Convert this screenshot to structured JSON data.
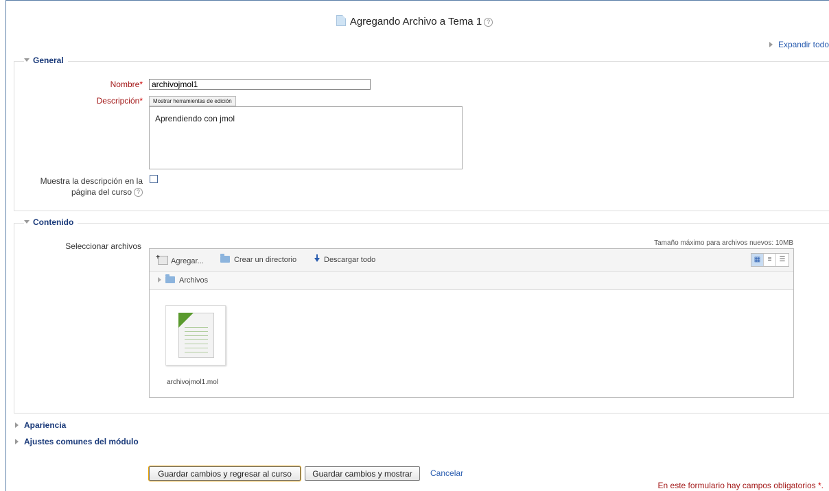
{
  "page": {
    "title": "Agregando Archivo a Tema 1",
    "expand_all": "Expandir todo"
  },
  "general": {
    "legend": "General",
    "name_label": "Nombre",
    "name_value": "archivojmol1",
    "description_label": "Descripción",
    "editor_toggle": "Mostrar herramientas de edición",
    "description_value": "Aprendiendo con jmol",
    "show_desc_label_1": "Muestra la descripción en la",
    "show_desc_label_2": "página del curso",
    "required_mark": "*"
  },
  "content": {
    "legend": "Contenido",
    "select_files_label": "Seleccionar archivos",
    "max_size": "Tamaño máximo para archivos nuevos: 10MB",
    "toolbar": {
      "add": "Agregar...",
      "create_dir": "Crear un directorio",
      "download_all": "Descargar todo"
    },
    "path": "Archivos",
    "file_name": "archivojmol1.mol"
  },
  "sections": {
    "appearance": "Apariencia",
    "common_settings": "Ajustes comunes del módulo"
  },
  "actions": {
    "save_return": "Guardar cambios y regresar al curso",
    "save_show": "Guardar cambios y mostrar",
    "cancel": "Cancelar",
    "required_note": "En este formulario hay campos obligatorios",
    "required_note_star": "*."
  }
}
